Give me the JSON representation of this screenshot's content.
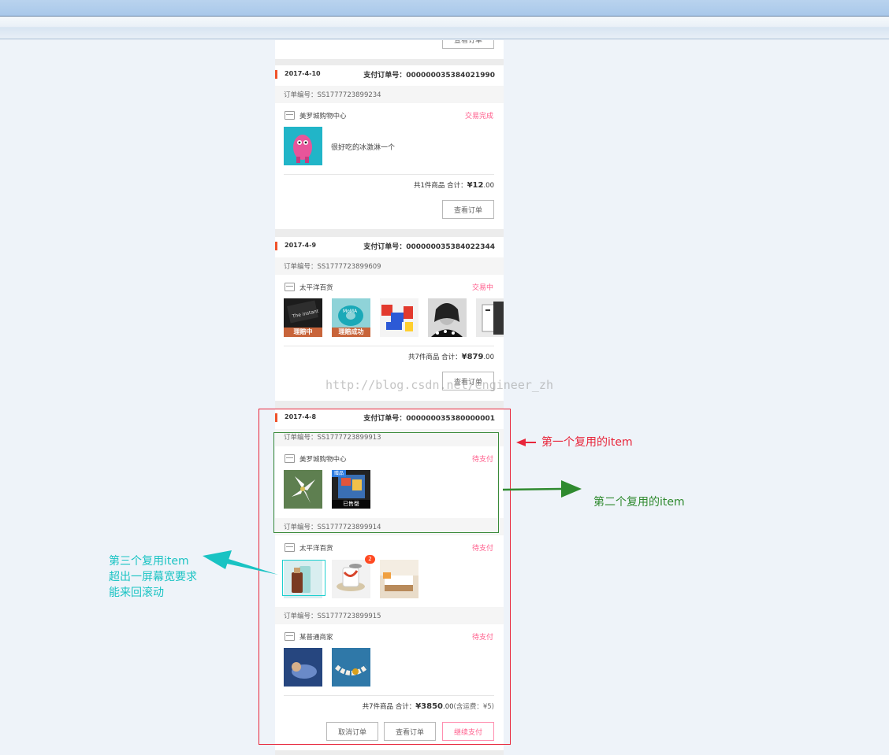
{
  "watermark": "http://blog.csdn.net/engineer_zh",
  "top_card": {
    "button": "查看订单"
  },
  "orders": [
    {
      "date": "2017-4-10",
      "pay_no": "支付订单号：000000035384021990",
      "order_no": "订单编号：SS1777723899234",
      "shop": "美罗城购物中心",
      "status": "交易完成",
      "desc": "很好吃的冰激淋一个",
      "summary_prefix": "共1件商品  合计：",
      "price_main": "¥12",
      "price_dec": ".00",
      "button": "查看订单"
    },
    {
      "date": "2017-4-9",
      "pay_no": "支付订单号：000000035384022344",
      "order_no": "订单编号：SS1777723899609",
      "shop": "太平洋百货",
      "status": "交易中",
      "tags": [
        "理赔中",
        "理赔成功"
      ],
      "summary_prefix": "共7件商品  合计：",
      "price_main": "¥879",
      "price_dec": ".00",
      "button": "查看订单"
    },
    {
      "date": "2017-4-8",
      "pay_no": "支付订单号：000000035380000001",
      "sub_orders": [
        {
          "order_no": "订单编号：SS1777723899913",
          "shop": "美罗城购物中心",
          "status": "待支付",
          "tag_top": "赠品",
          "tag_bottom": "已售罄"
        },
        {
          "order_no": "订单编号：SS1777723899914",
          "shop": "太平洋百货",
          "status": "待支付",
          "badge": "2"
        },
        {
          "order_no": "订单编号：SS1777723899915",
          "shop": "某普通商家",
          "status": "待支付"
        }
      ],
      "summary_prefix": "共7件商品  合计：",
      "price_main": "¥3850",
      "price_dec": ".00",
      "summary_suffix": "(含运费：¥5)",
      "buttons": {
        "cancel": "取消订单",
        "view": "查看订单",
        "pay": "继续支付"
      }
    }
  ],
  "annotations": {
    "first": "第一个复用的item",
    "second": "第二个复用的item",
    "third_line1": "第三个复用item",
    "third_line2": "超出一屏幕宽要求",
    "third_line3": "能来回滚动"
  },
  "colors": {
    "status_pink": "#ff5b8a",
    "date_bar": "#f0522b",
    "red_box": "#e8263b",
    "green_box": "#3a8a3a",
    "teal": "#19c3c3"
  }
}
